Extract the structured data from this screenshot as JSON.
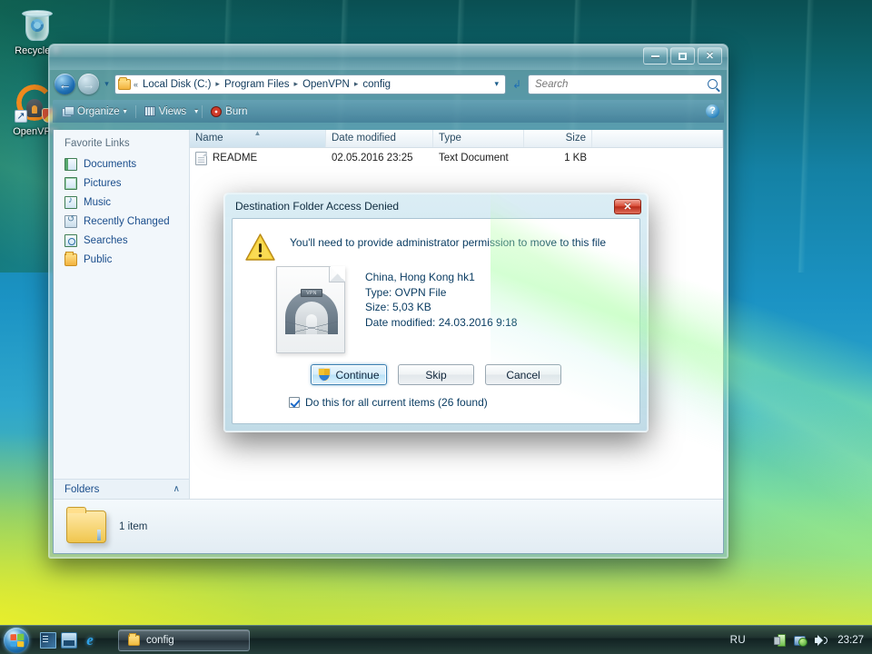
{
  "desktop": {
    "icons": [
      {
        "name": "Recycle B",
        "icon": "recycle-bin-icon"
      },
      {
        "name": "OpenVPN",
        "icon": "openvpn-shortcut-icon"
      }
    ]
  },
  "explorer": {
    "title": "",
    "window_controls": {
      "minimize": "–",
      "maximize": "❐",
      "close": "✕"
    },
    "address": {
      "chevrons": "«",
      "crumbs": [
        "Local Disk (C:)",
        "Program Files",
        "OpenVPN",
        "config"
      ],
      "separator": "▸",
      "dropdown_caret": "▾",
      "refresh_icon": "refresh-icon"
    },
    "search": {
      "placeholder": "Search",
      "value": ""
    },
    "nav": {
      "back": "←",
      "forward": "→",
      "history_caret": "▾"
    },
    "toolbar": {
      "organize": "Organize",
      "views": "Views",
      "burn": "Burn",
      "caret": "▾",
      "help": "?"
    },
    "sidebar": {
      "title": "Favorite Links",
      "items": [
        {
          "label": "Documents",
          "icon": "documents-icon"
        },
        {
          "label": "Pictures",
          "icon": "pictures-icon"
        },
        {
          "label": "Music",
          "icon": "music-icon"
        },
        {
          "label": "Recently Changed",
          "icon": "recently-changed-icon"
        },
        {
          "label": "Searches",
          "icon": "searches-icon"
        },
        {
          "label": "Public",
          "icon": "public-folder-icon"
        }
      ],
      "folders_label": "Folders",
      "folders_chevron": "∧"
    },
    "columns": [
      {
        "label": "Name",
        "key": "name"
      },
      {
        "label": "Date modified",
        "key": "date"
      },
      {
        "label": "Type",
        "key": "type"
      },
      {
        "label": "Size",
        "key": "size"
      }
    ],
    "sort_arrow": "▲",
    "rows": [
      {
        "name": "README",
        "date": "02.05.2016 23:25",
        "type": "Text Document",
        "size": "1 KB",
        "icon": "text-file-icon"
      }
    ],
    "status": {
      "text": "1 item",
      "icon": "folder-icon"
    }
  },
  "dialog": {
    "title": "Destination Folder Access Denied",
    "close_label": "✕",
    "warning_icon": "warning-triangle-icon",
    "message": "You'll need to provide administrator permission to move to this file",
    "file": {
      "icon": "ovpn-file-icon",
      "badge": "VPN",
      "name": "China, Hong Kong hk1",
      "type": "Type: OVPN File",
      "size": "Size: 5,03 KB",
      "date": "Date modified: 24.03.2016 9:18"
    },
    "buttons": [
      {
        "label": "Continue",
        "icon": "uac-shield-icon",
        "focused": true
      },
      {
        "label": "Skip",
        "icon": "",
        "focused": false
      },
      {
        "label": "Cancel",
        "icon": "",
        "focused": false
      }
    ],
    "checkbox": {
      "label": "Do this for all current items (26 found)",
      "checked": true
    }
  },
  "taskbar": {
    "start_icon": "windows-start-orb",
    "quicklaunch": [
      {
        "icon": "show-desktop-icon"
      },
      {
        "icon": "switch-windows-icon"
      },
      {
        "icon": "internet-explorer-icon",
        "glyph": "e"
      }
    ],
    "tasks": [
      {
        "label": "config",
        "icon": "folder-icon"
      }
    ],
    "tray": {
      "language": "RU",
      "icons": [
        "power-icon",
        "network-icon",
        "volume-icon"
      ],
      "clock": "23:27"
    }
  }
}
